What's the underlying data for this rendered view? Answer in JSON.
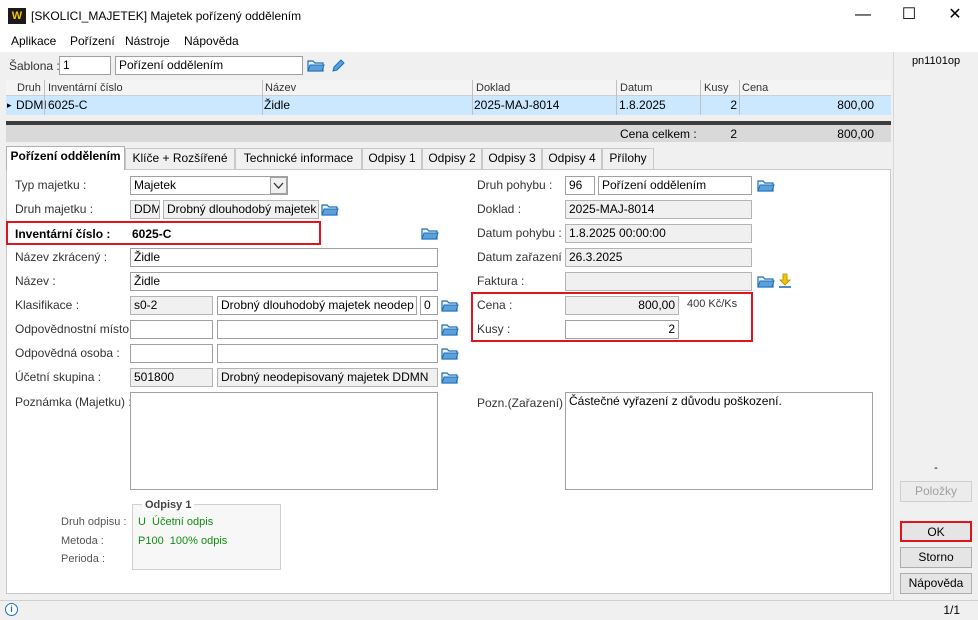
{
  "window": {
    "title": "[SKOLICI_MAJETEK] Majetek pořízený oddělením",
    "logo_text": "W",
    "minimize_glyph": "—",
    "maximize_glyph": "☐",
    "close_glyph": "✕"
  },
  "menu": [
    "Aplikace",
    "Pořízení",
    "Nástroje",
    "Nápověda"
  ],
  "template": {
    "label": "Šablona :",
    "number": "1",
    "name": "Pořízení oddělením"
  },
  "grid": {
    "columns": [
      "Druh",
      "Inventární číslo",
      "Název",
      "Doklad",
      "Datum",
      "Kusy",
      "Cena"
    ],
    "rows": [
      {
        "marker": "▸",
        "druh": "DDMI",
        "inventarni_cislo": "6025-C",
        "nazev": "Židle",
        "doklad": "2025-MAJ-8014",
        "datum": "1.8.2025",
        "kusy": "2",
        "cena": "800,00"
      }
    ],
    "total_label": "Cena celkem :",
    "total_kusy": "2",
    "total_cena": "800,00"
  },
  "tabs": [
    "Pořízení oddělením",
    "Klíče + Rozšířené",
    "Technické informace",
    "Odpisy 1",
    "Odpisy 2",
    "Odpisy 3",
    "Odpisy 4",
    "Přílohy"
  ],
  "form_left": {
    "typ_majetku_label": "Typ majetku :",
    "typ_majetku_value": "Majetek",
    "druh_majetku_label": "Druh majetku :",
    "druh_majetku_code": "DDM",
    "druh_majetku_name": "Drobný dlouhodobý majetek",
    "inventarni_label": "Inventární číslo :",
    "inventarni_value": "6025-C",
    "nazev_zkraceny_label": "Název zkrácený :",
    "nazev_zkraceny_value": "Židle",
    "nazev_label": "Název :",
    "nazev_value": "Židle",
    "klasifikace_label": "Klasifikace :",
    "klasifikace_code": "s0-2",
    "klasifikace_name": "Drobný dlouhodobý majetek neodep",
    "klasifikace_num": "0",
    "odpovednostni_label": "Odpovědnostní místo :",
    "odpovedna_osoba_label": "Odpovědná osoba :",
    "ucetni_skupina_label": "Účetní skupina :",
    "ucetni_skupina_code": "501800",
    "ucetni_skupina_name": "Drobný neodepisovaný majetek DDMN",
    "poznamka_label": "Poznámka (Majetku) :"
  },
  "form_right": {
    "druh_pohybu_label": "Druh pohybu :",
    "druh_pohybu_code": "96",
    "druh_pohybu_name": "Pořízení oddělením",
    "doklad_label": "Doklad :",
    "doklad_value": "2025-MAJ-8014",
    "datum_pohybu_label": "Datum pohybu :",
    "datum_pohybu_value": "1.8.2025 00:00:00",
    "datum_zarazeni_label": "Datum zařazení :",
    "datum_zarazeni_value": "26.3.2025",
    "faktura_label": "Faktura :",
    "cena_label": "Cena :",
    "cena_value": "800,00",
    "cena_unit": "400 Kč/Ks",
    "kusy_label": "Kusy :",
    "kusy_value": "2",
    "pozn_label": "Pozn.(Zařazení) :",
    "pozn_value": "Částečné vyřazení z důvodu poškození."
  },
  "odpisy": {
    "title": "Odpisy 1",
    "druh_label": "Druh odpisu :",
    "druh_value": "U  Účetní odpis",
    "metoda_label": "Metoda :",
    "metoda_value": "P100  100% odpis",
    "perioda_label": "Perioda :"
  },
  "side": {
    "code": "pn1101op",
    "dash": "-",
    "polozky": "Položky",
    "ok": "OK",
    "storno": "Storno",
    "napoveda": "Nápověda"
  },
  "status": {
    "info_glyph": "i",
    "page": "1/1"
  },
  "colors": {
    "highlight_red": "#e0141e",
    "row_selected": "#cce8ff",
    "green_text": "#118a11"
  }
}
